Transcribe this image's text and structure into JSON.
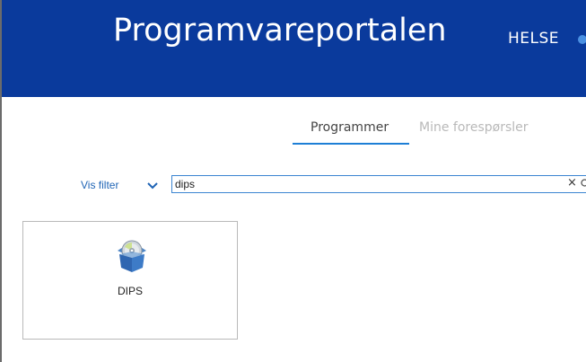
{
  "header": {
    "title": "Programvareportalen",
    "brand": "HELSE"
  },
  "tabs": [
    {
      "label": "Programmer",
      "active": true
    },
    {
      "label": "Mine forespørsler",
      "active": false
    }
  ],
  "filter": {
    "toggle_label": "Vis filter"
  },
  "search": {
    "value": "dips",
    "clear_glyph": "×"
  },
  "results": [
    {
      "name": "DIPS",
      "icon": "software-package-icon"
    }
  ],
  "colors": {
    "header_bg": "#0a3a9c",
    "accent": "#1e7fd6",
    "link": "#1f64b5"
  }
}
